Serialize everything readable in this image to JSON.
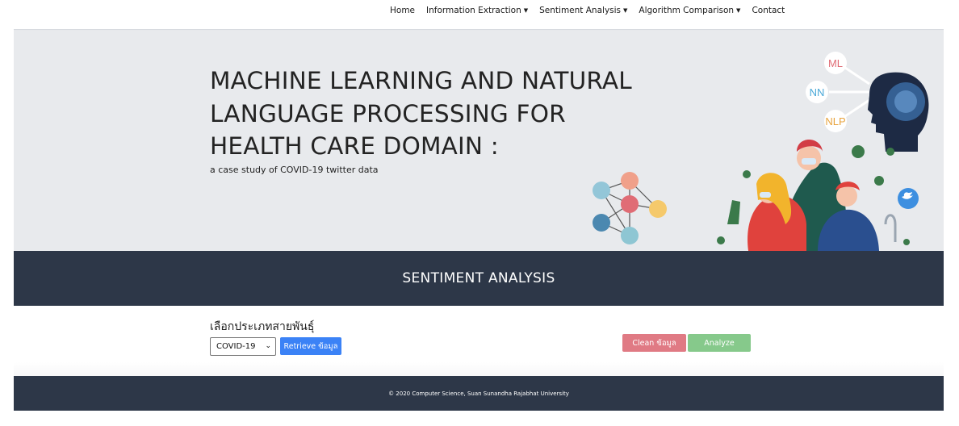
{
  "nav": {
    "items": [
      {
        "label": "Home",
        "dropdown": false
      },
      {
        "label": "Information Extraction",
        "dropdown": true
      },
      {
        "label": "Sentiment Analysis",
        "dropdown": true
      },
      {
        "label": "Algorithm Comparison",
        "dropdown": true
      },
      {
        "label": "Contact",
        "dropdown": false
      }
    ]
  },
  "hero": {
    "title_lines": [
      "MACHINE LEARNING AND NATURAL",
      "LANGUAGE PROCESSING FOR",
      "HEALTH CARE DOMAIN :"
    ],
    "subtitle": "a case study of COVID-19 twitter data",
    "art_labels": {
      "ml": "ML",
      "nn": "NN",
      "nlp": "NLP"
    }
  },
  "banner": {
    "title": "SENTIMENT ANALYSIS"
  },
  "controls": {
    "select_label": "เลือกประเภทสายพันธุ์",
    "select_value": "COVID-19",
    "retrieve_label": "Retrieve ข้อมูล",
    "clean_label": "Clean ข้อมูล",
    "analyze_label": "Analyze"
  },
  "footer": {
    "text": "© 2020 Computer Science, Suan Sunandha Rajabhat University"
  },
  "colors": {
    "dark_band": "#2d3748",
    "hero_bg": "#e8eaed",
    "retrieve": "#3b82f6",
    "clean": "#e07a84",
    "analyze": "#86c98b"
  }
}
